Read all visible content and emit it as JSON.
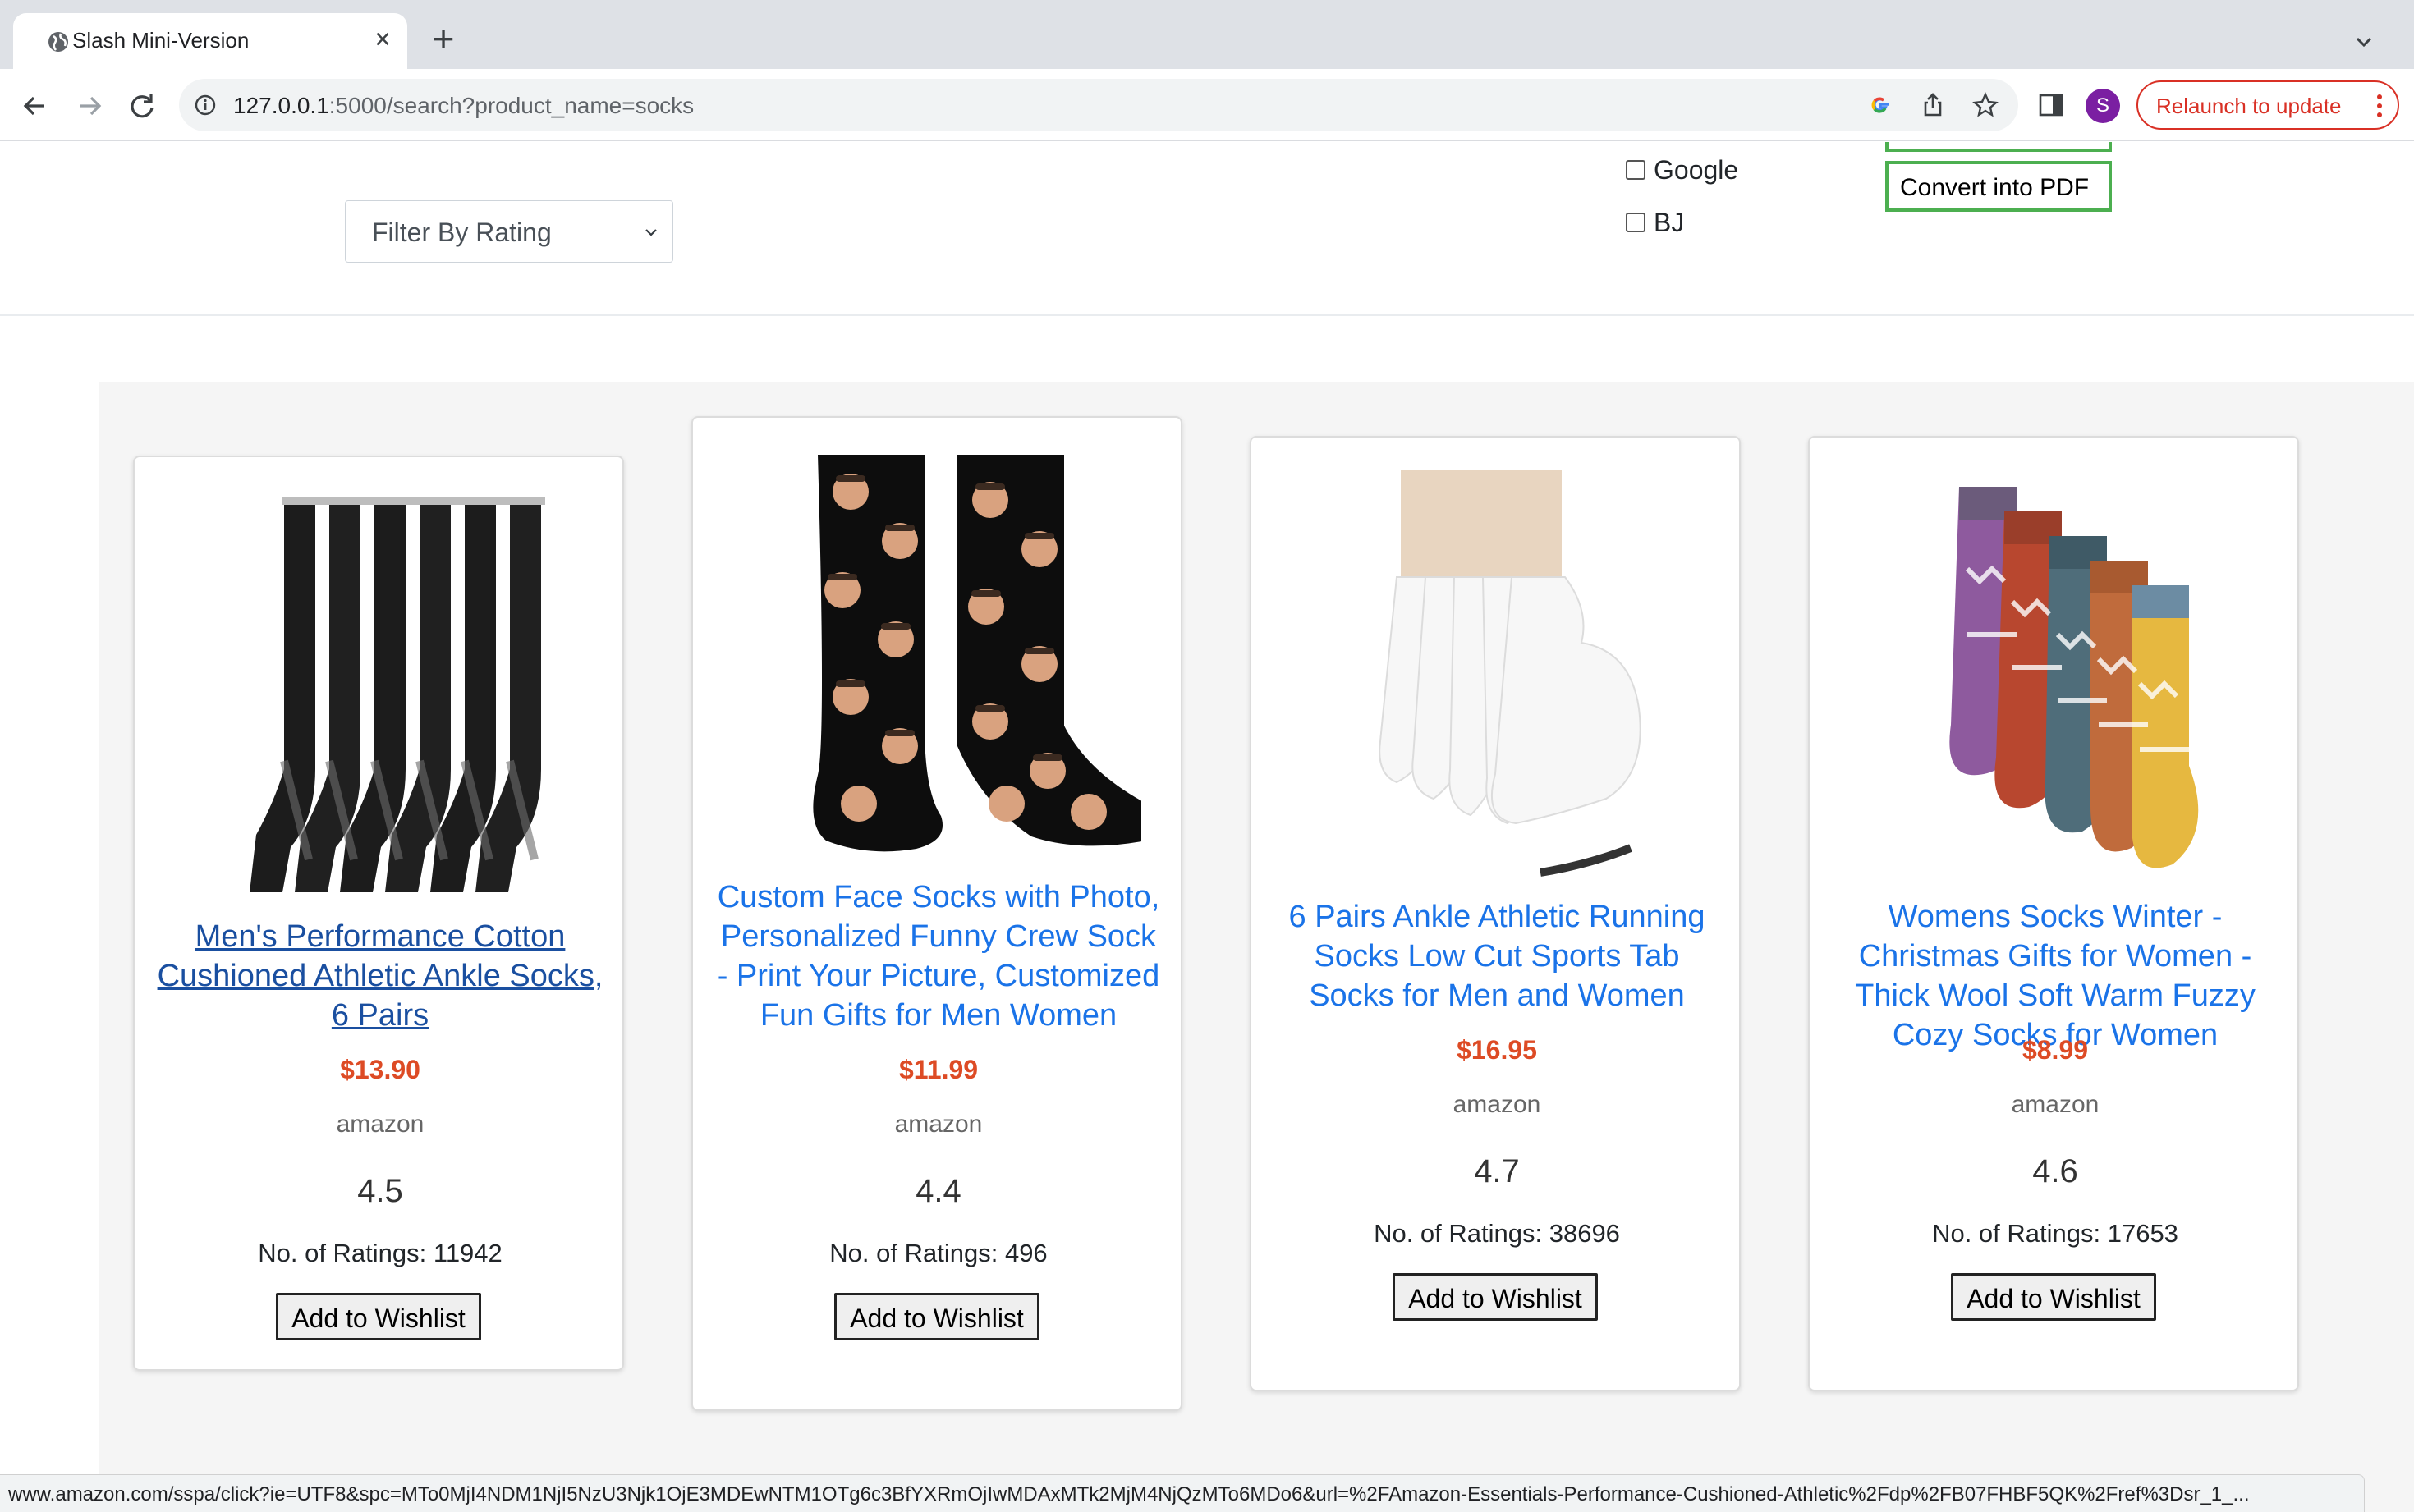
{
  "browser": {
    "tab_title": "Slash Mini-Version",
    "url_host": "127.0.0.1",
    "url_rest": ":5000/search?product_name=socks",
    "relaunch_label": "Relaunch to update",
    "profile_initial": "S",
    "accent_color": "#d93025"
  },
  "filters": {
    "rating_select": "Filter By Rating",
    "sites": [
      {
        "label": "Google",
        "checked": false
      },
      {
        "label": "BJ",
        "checked": false
      }
    ],
    "convert_pdf_label": "Convert into PDF"
  },
  "products": [
    {
      "title": "Men's Performance Cotton Cushioned Athletic Ankle Socks, 6 Pairs",
      "price": "$13.90",
      "source": "amazon",
      "rating": "4.5",
      "ratings_count": "No. of Ratings: 11942",
      "wishlist_label": "Add to Wishlist",
      "image": "black-athletic-socks"
    },
    {
      "title": "Custom Face Socks with Photo, Personalized Funny Crew Sock - Print Your Picture, Customized Fun Gifts for Men Women",
      "price": "$11.99",
      "source": "amazon",
      "rating": "4.4",
      "ratings_count": "No. of Ratings: 496",
      "wishlist_label": "Add to Wishlist",
      "image": "custom-face-socks"
    },
    {
      "title": "6 Pairs Ankle Athletic Running Socks Low Cut Sports Tab Socks for Men and Women",
      "price": "$16.95",
      "source": "amazon",
      "rating": "4.7",
      "ratings_count": "No. of Ratings: 38696",
      "wishlist_label": "Add to Wishlist",
      "image": "white-ankle-socks"
    },
    {
      "title": "Womens Socks Winter - Christmas Gifts for Women - Thick Wool Soft Warm Fuzzy Cozy Socks for Women",
      "price": "$8.99",
      "source": "amazon",
      "rating": "4.6",
      "ratings_count": "No. of Ratings: 17653",
      "wishlist_label": "Add to Wishlist",
      "image": "colorful-wool-socks"
    }
  ],
  "status_url": "www.amazon.com/sspa/click?ie=UTF8&spc=MTo0MjI4NDM1NjI5NzU3Njk1OjE3MDEwNTM1OTg6c3BfYXRmOjIwMDAxMTk2MjM4NjQzMTo6MDo6&url=%2FAmazon-Essentials-Performance-Cushioned-Athletic%2Fdp%2FB07FHBF5QK%2Fref%3Dsr_1_..."
}
